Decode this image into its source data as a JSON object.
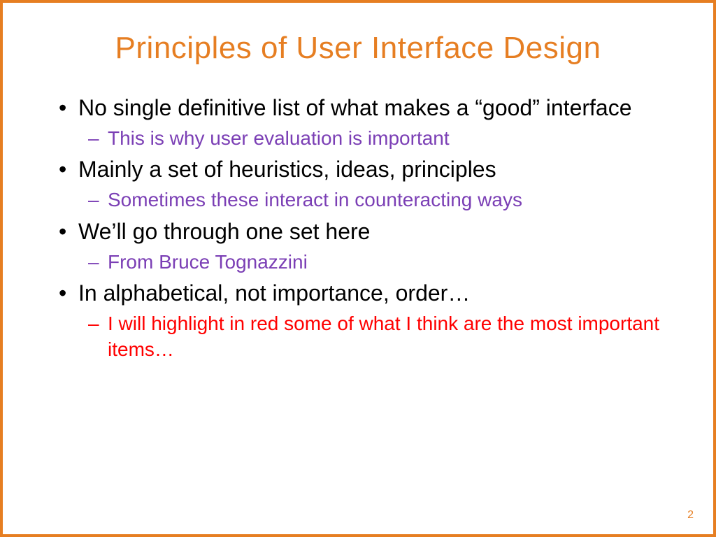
{
  "slide": {
    "title": "Principles of User Interface Design",
    "bullets": [
      {
        "text": "No single definitive list of what makes a “good” interface",
        "sub": {
          "text": "This is why user evaluation is important",
          "color": "purple"
        }
      },
      {
        "text": "Mainly a set of heuristics, ideas, principles",
        "sub": {
          "text": "Sometimes these interact in counteracting ways",
          "color": "purple"
        }
      },
      {
        "text": "We’ll go through one set here",
        "sub": {
          "text": "From Bruce Tognazzini",
          "color": "purple"
        }
      },
      {
        "text": "In alphabetical, not importance, order…",
        "sub": {
          "text": "I will highlight in red some of what I think are the most important items…",
          "color": "red"
        }
      }
    ],
    "pageNumber": "2"
  },
  "colors": {
    "accent": "#e67e22",
    "purple": "#7b3fb5",
    "red": "#ff0000"
  }
}
